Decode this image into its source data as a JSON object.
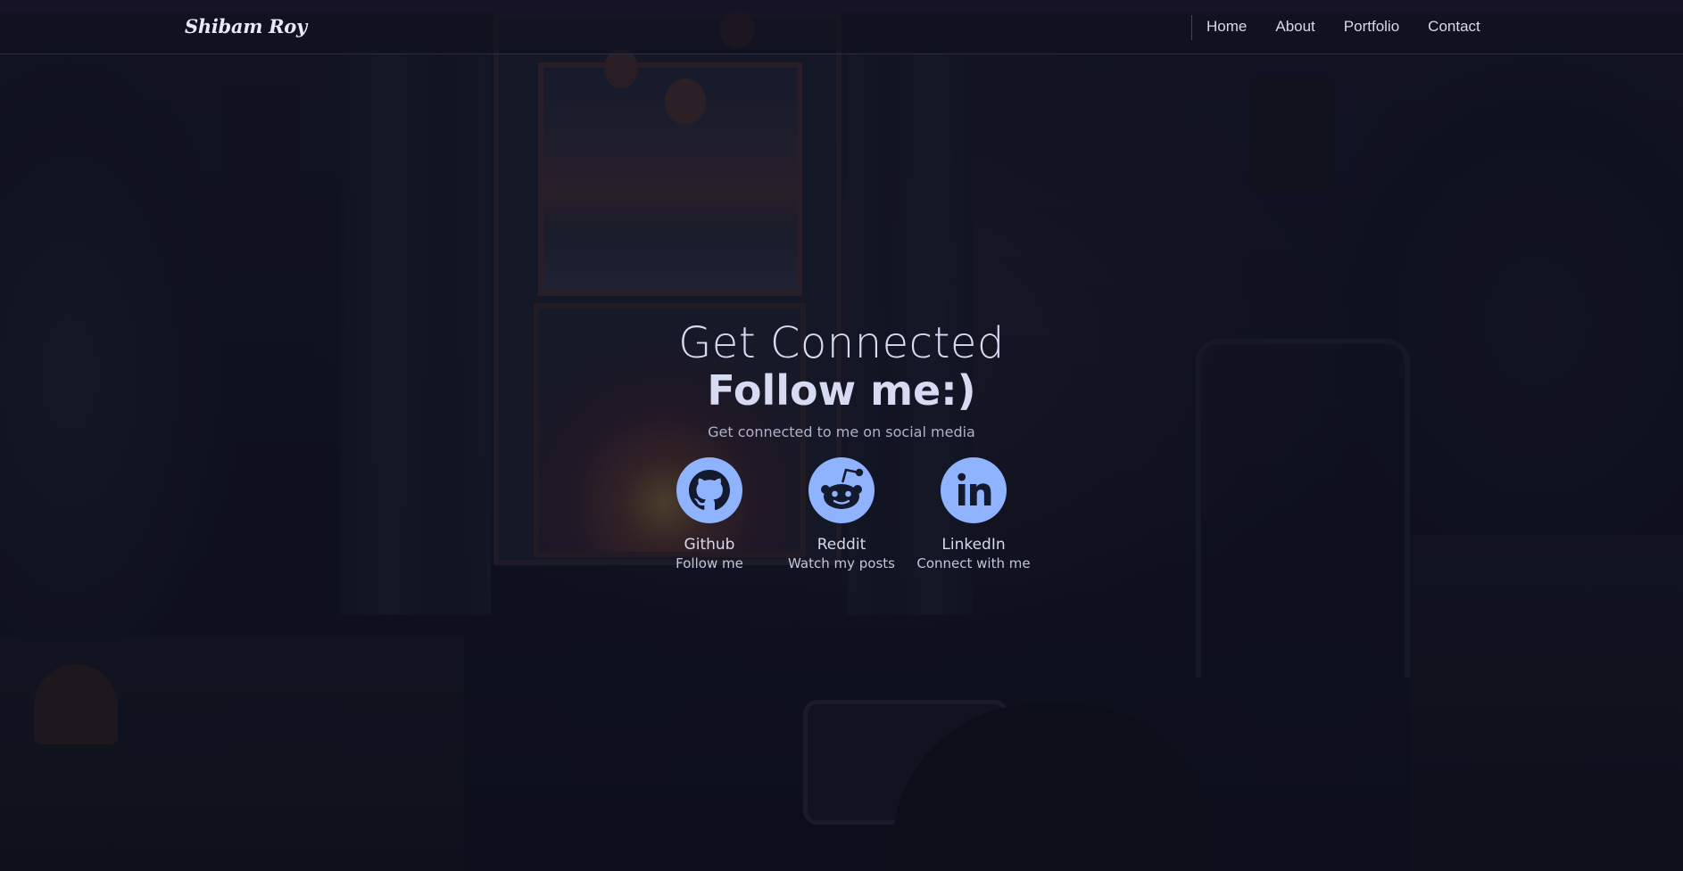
{
  "brand": {
    "name": "Shibam Roy"
  },
  "nav": {
    "items": [
      {
        "label": "Home"
      },
      {
        "label": "About"
      },
      {
        "label": "Portfolio"
      },
      {
        "label": "Contact"
      }
    ]
  },
  "hero": {
    "title": "Get Connected",
    "subtitle": "Follow me:)",
    "description": "Get connected to me on social media"
  },
  "social": {
    "items": [
      {
        "name": "Github",
        "caption": "Follow me",
        "icon": "github-icon"
      },
      {
        "name": "Reddit",
        "caption": "Watch my posts",
        "icon": "reddit-icon"
      },
      {
        "name": "LinkedIn",
        "caption": "Connect with me",
        "icon": "linkedin-icon"
      }
    ]
  },
  "colors": {
    "accent_icon": "#8fb3ff",
    "icon_glyph": "#131a2e",
    "text": "#d6daf2",
    "background": "#121626"
  }
}
